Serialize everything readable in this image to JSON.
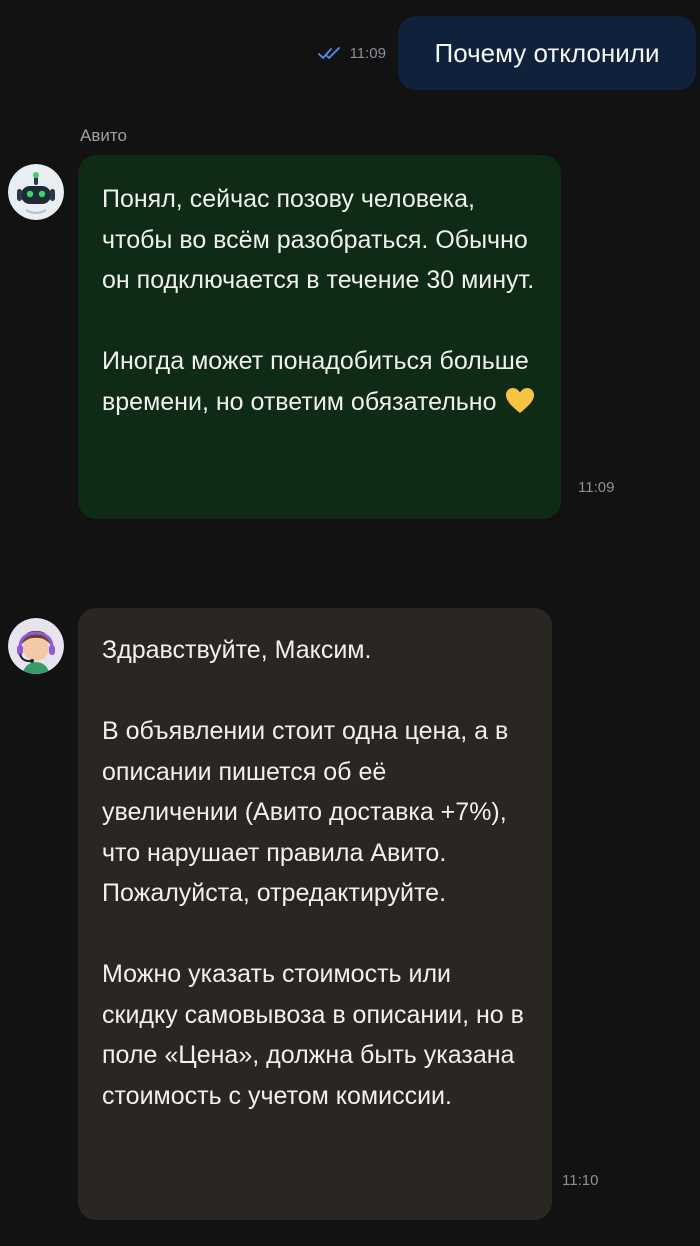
{
  "outgoing": {
    "time": "11:09",
    "text": "Почему отклонили",
    "status_icon": "double-check-icon"
  },
  "bot_message": {
    "sender": "Авито",
    "avatar": "robot-avatar",
    "paragraphs": [
      "Понял, сейчас позову человека, чтобы во всём разобраться. Обычно он подключается в течение 30 минут.",
      "Иногда может понадобиться больше времени, но ответим обязательно"
    ],
    "emoji": "💛",
    "time": "11:09"
  },
  "agent_message": {
    "avatar": "support-agent-avatar",
    "paragraphs": [
      "Здравствуйте, Максим.",
      "В объявлении стоит одна цена, а в описании пишется об её увеличении (Авито доставка +7%), что нарушает правила Авито. Пожалуйста, отредактируйте.",
      "Можно указать стоимость или скидку самовывоза в описании, но в поле «Цена», должна быть указана стоимость с учетом комиссии."
    ],
    "time": "11:10"
  },
  "colors": {
    "background": "#121212",
    "outgoing_bubble": "#10213c",
    "bot_bubble": "#0f2a15",
    "agent_bubble": "#2a2722",
    "check_color": "#4f8ef7",
    "heart_color": "#f5c542"
  }
}
